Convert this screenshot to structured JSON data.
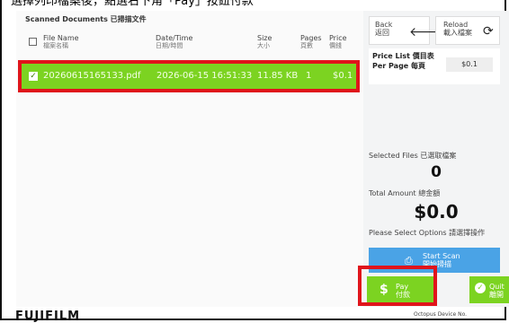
{
  "caption": "選擇列印檔案後，點選右下角「Pay」按鈕付款",
  "left": {
    "title": "Scanned Documents 已掃描文件",
    "headers": {
      "filename": "File Name",
      "filename_sub": "檔案名稱",
      "datetime": "Date/Time",
      "datetime_sub": "日期/時間",
      "size": "Size",
      "size_sub": "大小",
      "pages": "Pages",
      "pages_sub": "頁數",
      "price": "Price",
      "price_sub": "價錢"
    },
    "rows": [
      {
        "checked": true,
        "filename": "20260615165133.pdf",
        "datetime": "2026-06-15 16:51:33",
        "size": "11.85 KB",
        "pages": "1",
        "price": "$0.1"
      }
    ]
  },
  "right": {
    "back": {
      "label": "Back",
      "label_sub": "返回",
      "icon": "arrow-left-icon"
    },
    "reload": {
      "label": "Reload",
      "label_sub": "載入檔案",
      "icon": "reload-icon"
    },
    "price_list_title": "Price List 價目表",
    "per_page_label": "Per Page 每頁",
    "per_page_value": "$0.1",
    "selected_files_label": "Selected Files 已選取檔案",
    "selected_files_count": "0",
    "total_amount_label": "Total Amount 總金額",
    "total_amount_value": "$0.0",
    "options_label": "Please Select Options 請選擇操作",
    "start_scan": {
      "label": "Start Scan",
      "label_sub": "開始掃描"
    },
    "pay": {
      "label": "Pay",
      "label_sub": "付款"
    },
    "quit": {
      "label": "Quit",
      "label_sub": "離開"
    }
  },
  "footer": {
    "brand": "FUJIFILM",
    "device": "Octopus Device No."
  },
  "colors": {
    "accent_green": "#7cd321",
    "scan_blue": "#4aa3e6",
    "highlight_red": "#e0141b"
  }
}
